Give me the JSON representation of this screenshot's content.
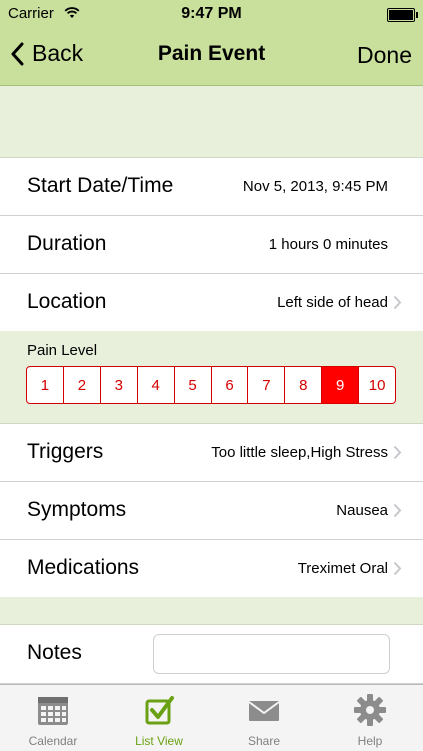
{
  "status_bar": {
    "carrier": "Carrier",
    "time": "9:47 PM"
  },
  "nav": {
    "back_label": "Back",
    "title": "Pain Event",
    "done_label": "Done"
  },
  "rows": {
    "start": {
      "label": "Start Date/Time",
      "value": "Nov 5, 2013, 9:45 PM"
    },
    "duration": {
      "label": "Duration",
      "value": "1 hours 0 minutes"
    },
    "location": {
      "label": "Location",
      "value": "Left side of head"
    },
    "triggers": {
      "label": "Triggers",
      "value": "Too little sleep,High Stress"
    },
    "symptoms": {
      "label": "Symptoms",
      "value": "Nausea"
    },
    "medications": {
      "label": "Medications",
      "value": "Treximet Oral"
    }
  },
  "pain": {
    "label": "Pain Level",
    "levels": [
      "1",
      "2",
      "3",
      "4",
      "5",
      "6",
      "7",
      "8",
      "9",
      "10"
    ],
    "selected": "9"
  },
  "notes": {
    "label": "Notes",
    "value": ""
  },
  "tabs": [
    {
      "label": "Calendar",
      "icon": "calendar-icon"
    },
    {
      "label": "List View",
      "icon": "checkbox-icon"
    },
    {
      "label": "Share",
      "icon": "envelope-icon"
    },
    {
      "label": "Help",
      "icon": "gear-icon"
    }
  ],
  "colors": {
    "header": "#c9df9c",
    "band": "#e8f0dc",
    "scale_red": "#d40000",
    "active_tab": "#6aa014"
  }
}
